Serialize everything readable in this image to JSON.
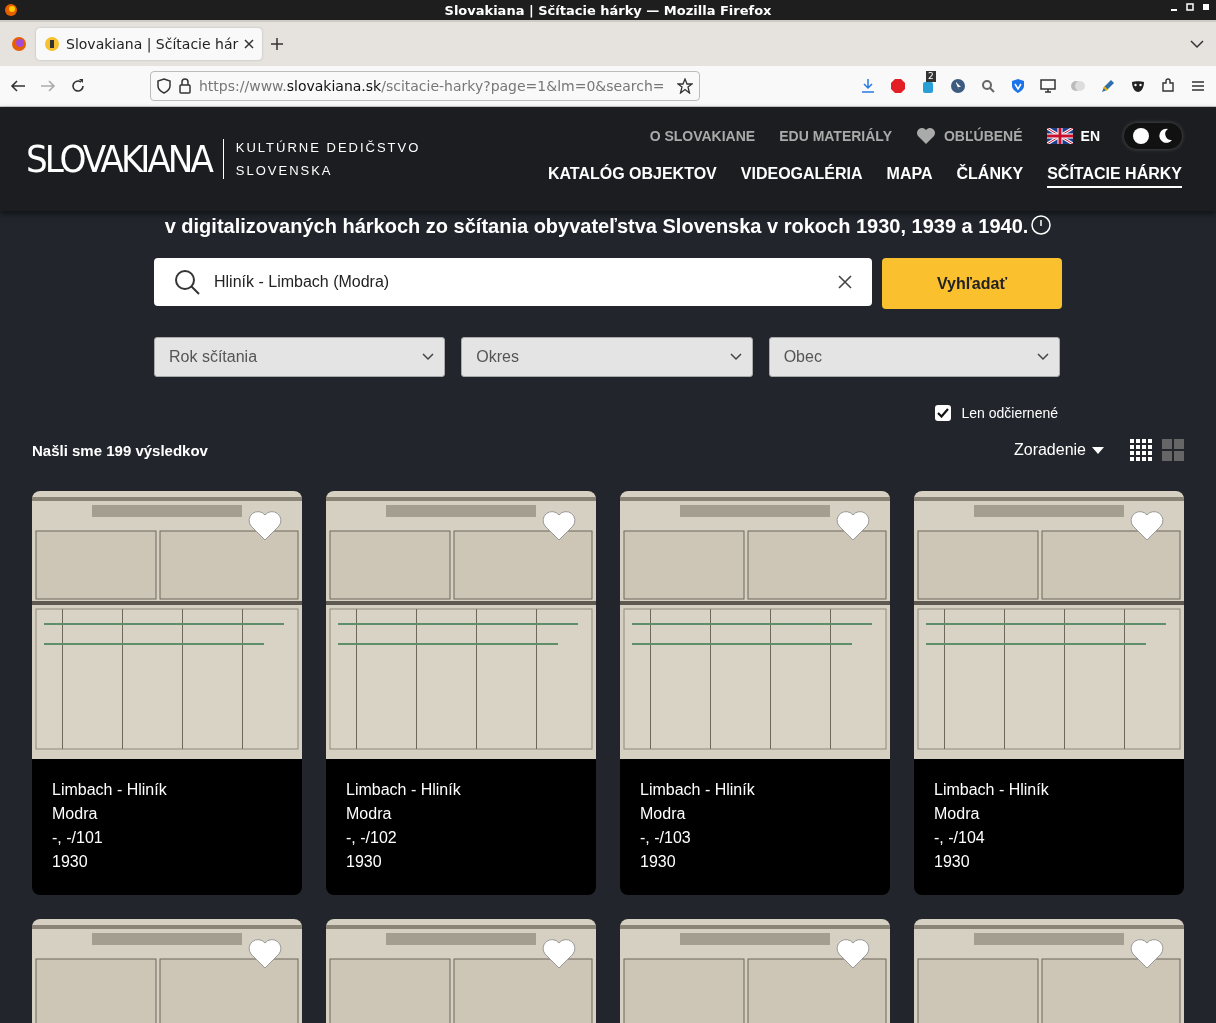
{
  "browser": {
    "window_title": "Slovakiana | Sčítacie hárky — Mozilla Firefox",
    "tab": {
      "title": "Slovakiana | Sčítacie hár"
    },
    "url": {
      "prefix": "https://www.",
      "domain": "slovakiana.sk",
      "path": "/scitacie-harky?page=1&lm=0&search="
    },
    "badge_count": "2"
  },
  "header": {
    "logo": "SLOVAKIANA",
    "tagline": [
      "KULTÚRNE DEDIČSTVO",
      "SLOVENSKA"
    ],
    "top_nav": [
      {
        "label": "O SLOVAKIANE",
        "kind": "link"
      },
      {
        "label": "EDU MATERIÁLY",
        "kind": "link"
      },
      {
        "label": "OBĽÚBENÉ",
        "kind": "favorites"
      },
      {
        "label": "EN",
        "kind": "language"
      }
    ],
    "theme_toggle": {
      "on": true
    },
    "main_nav": [
      {
        "label": "KATALÓG OBJEKTOV",
        "selected": false
      },
      {
        "label": "VIDEOGALÉRIA",
        "selected": false
      },
      {
        "label": "MAPA",
        "selected": false
      },
      {
        "label": "ČLÁNKY",
        "selected": false
      },
      {
        "label": "SČÍTACIE HÁRKY",
        "selected": true
      }
    ]
  },
  "intro": "v digitalizovaných hárkoch zo sčítania obyvateľstva Slovenska v rokoch 1930, 1939 a 1940.",
  "search": {
    "value": "Hliník - Limbach (Modra)",
    "button": "Vyhľadať"
  },
  "filters": [
    {
      "label": "Rok sčítania"
    },
    {
      "label": "Okres"
    },
    {
      "label": "Obec"
    }
  ],
  "only_blackened": {
    "label": "Len odčiernené",
    "checked": true
  },
  "results_count": "Našli sme 199 výsledkov",
  "sort": "Zoradenie",
  "views": [
    {
      "kind": "dense",
      "selected": true
    },
    {
      "kind": "large",
      "selected": false
    }
  ],
  "results": [
    {
      "kind": "card",
      "lines": [
        "Limbach - Hliník",
        "Modra",
        "-, -/101",
        "1930"
      ]
    },
    {
      "kind": "card",
      "lines": [
        "Limbach - Hliník",
        "Modra",
        "-, -/102",
        "1930"
      ]
    },
    {
      "kind": "card",
      "lines": [
        "Limbach - Hliník",
        "Modra",
        "-, -/103",
        "1930"
      ]
    },
    {
      "kind": "card",
      "lines": [
        "Limbach - Hliník",
        "Modra",
        "-, -/104",
        "1930"
      ]
    },
    {
      "kind": "picture"
    },
    {
      "kind": "picture"
    },
    {
      "kind": "picture"
    },
    {
      "kind": "picture"
    }
  ]
}
